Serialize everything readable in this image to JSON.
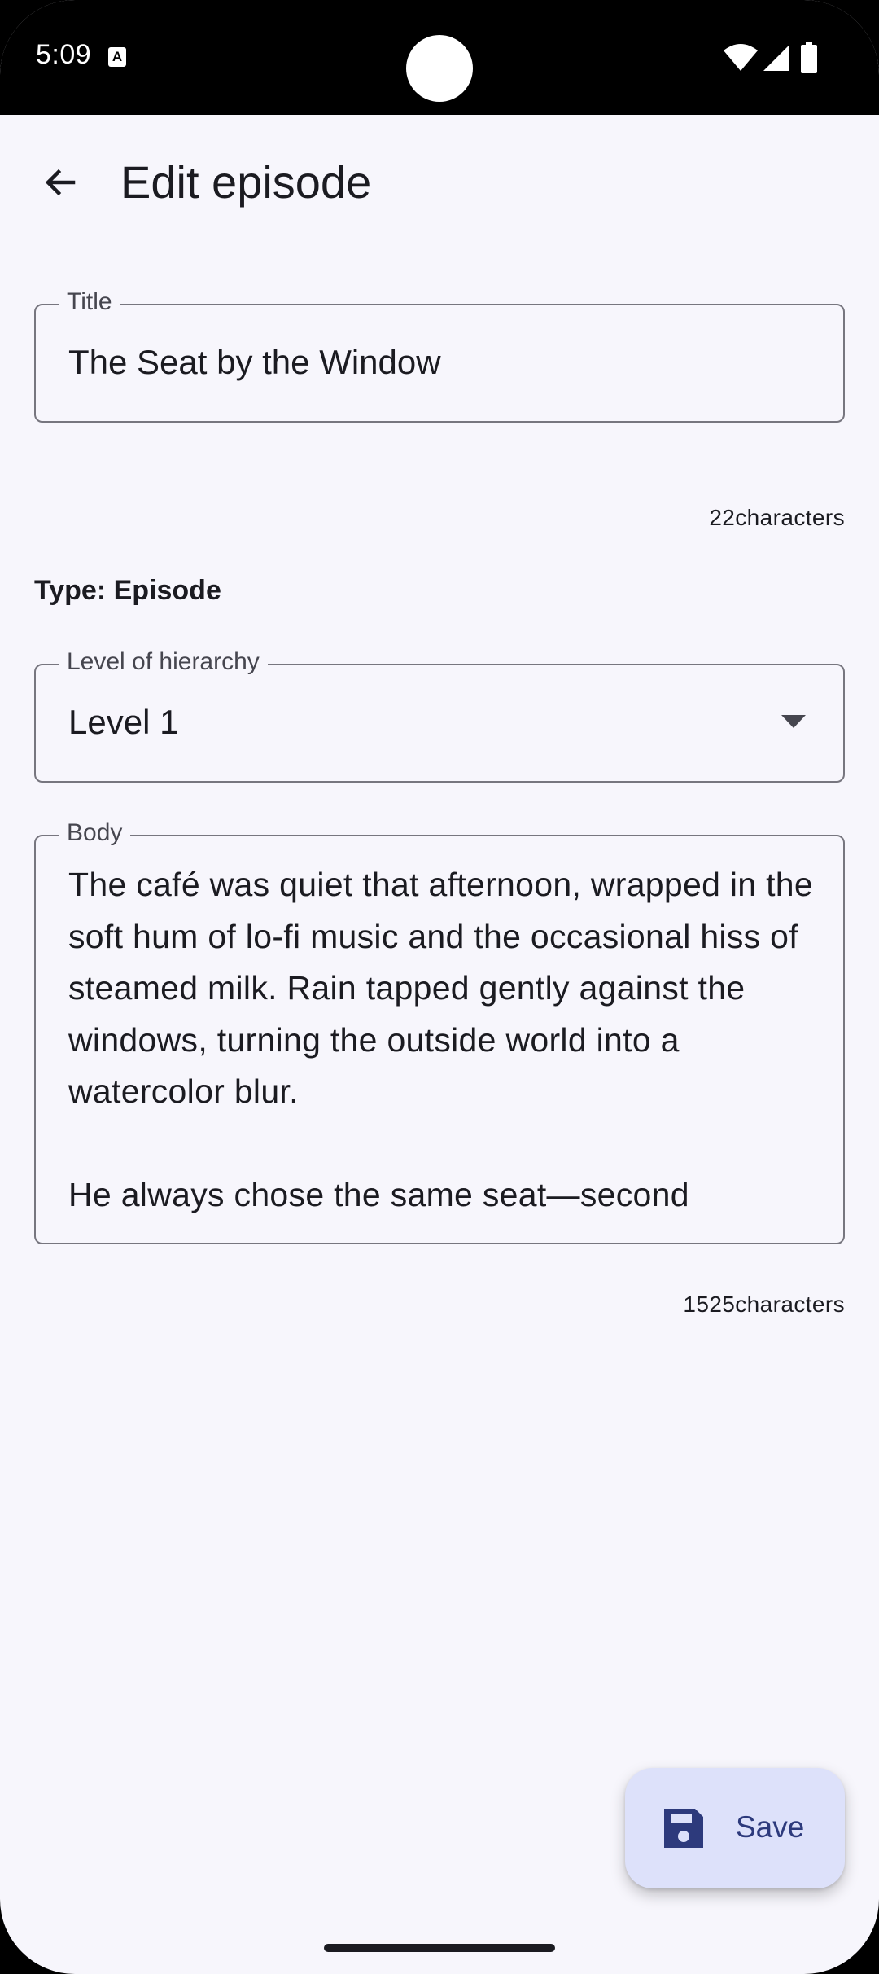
{
  "status_bar": {
    "time": "5:09",
    "notification_icon_letter": "A",
    "icons": [
      "wifi-icon",
      "signal-icon",
      "battery-icon"
    ]
  },
  "app_bar": {
    "title": "Edit episode",
    "back_icon": "arrow-back-icon"
  },
  "form": {
    "title_field": {
      "label": "Title",
      "value": "The Seat by the Window",
      "char_count": "22characters"
    },
    "type_text": "Type: Episode",
    "level_field": {
      "label": "Level of hierarchy",
      "value": "Level 1",
      "icon": "dropdown-arrow-icon"
    },
    "body_field": {
      "label": "Body",
      "value": "The café was quiet that afternoon, wrapped in the soft hum of lo-fi music and the occasional hiss of steamed milk. Rain tapped gently against the windows, turning the outside world into a watercolor blur.\n\nHe always chose the same seat—second",
      "char_count": "1525characters"
    }
  },
  "fab": {
    "label": "Save",
    "icon": "save-icon"
  },
  "colors": {
    "background": "#f7f6fc",
    "fab_background": "#dde1fa",
    "fab_foreground": "#2d3a7c",
    "outline": "#77767f"
  }
}
